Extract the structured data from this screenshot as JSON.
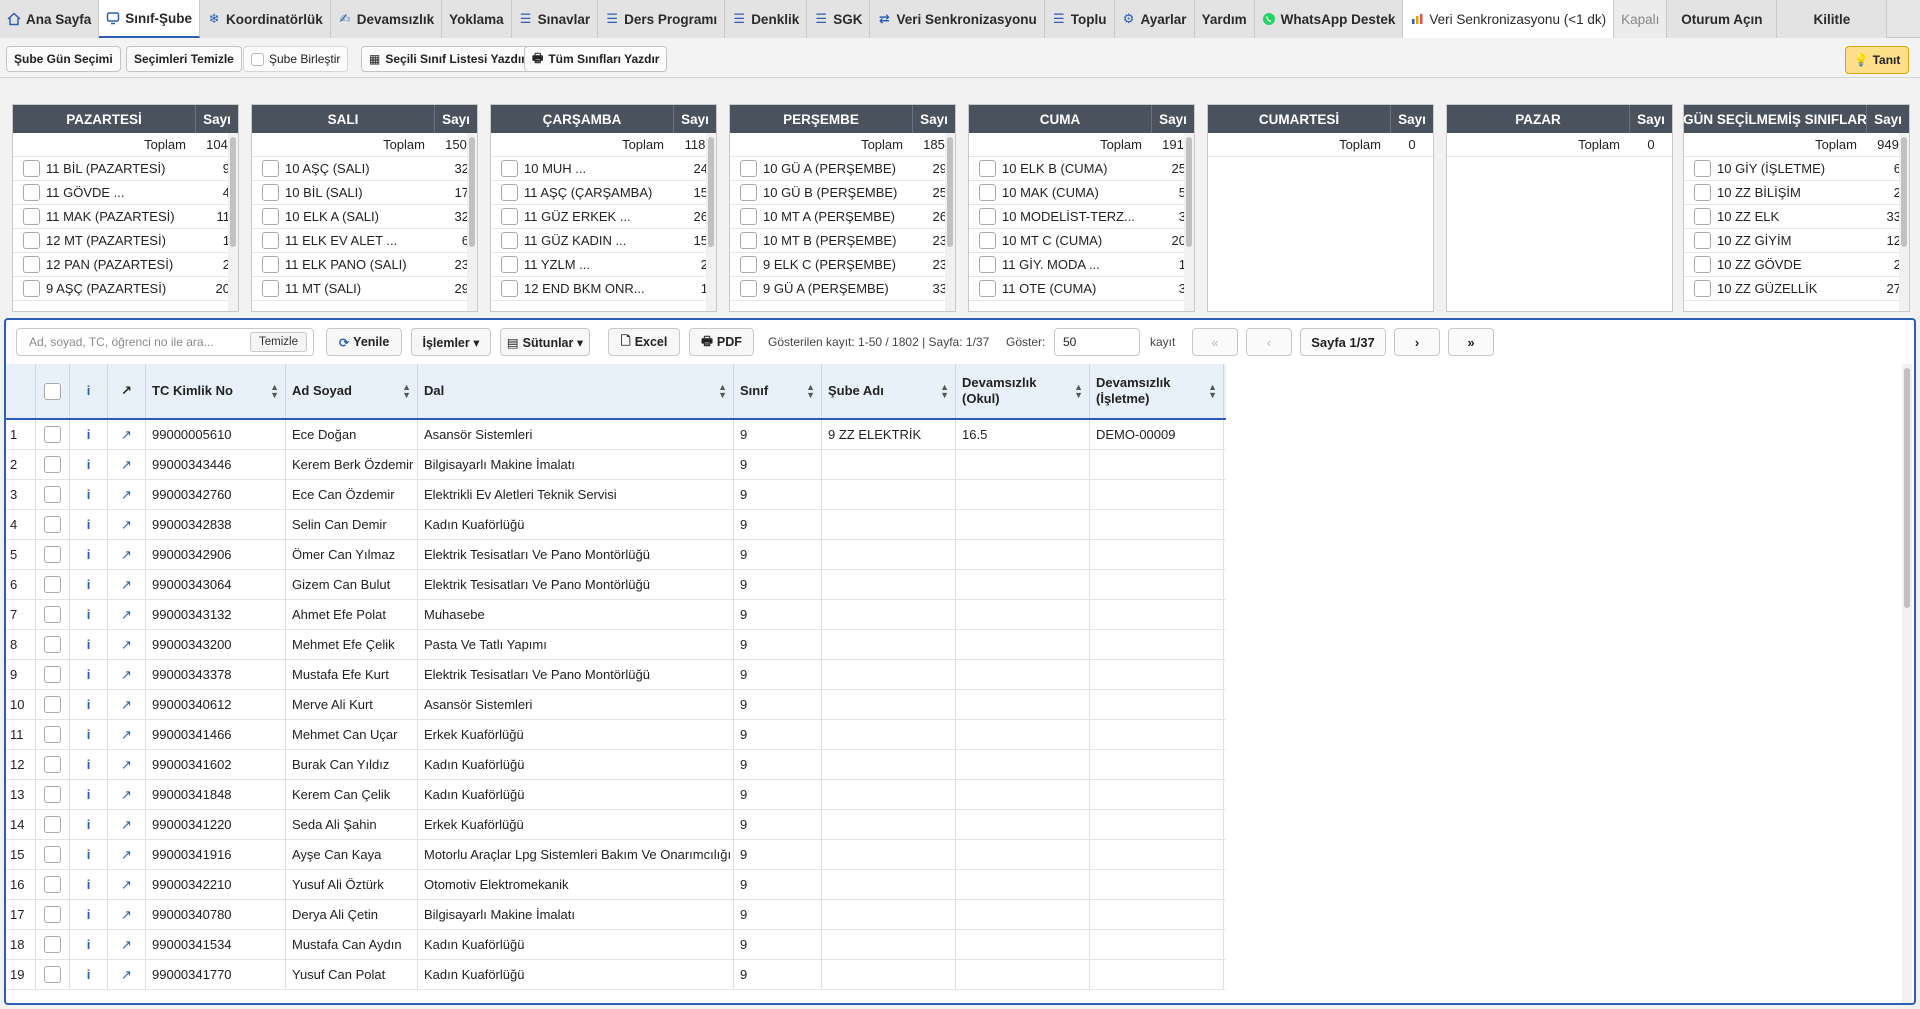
{
  "tabs": [
    {
      "label": "Ana Sayfa",
      "icon": "home-icon"
    },
    {
      "label": "Sınıf-Şube",
      "icon": "monitor-icon"
    },
    {
      "label": "Koordinatörlük",
      "icon": "snowflake-icon"
    },
    {
      "label": "Devamsızlık",
      "icon": "signature-icon"
    },
    {
      "label": "Yoklama",
      "icon": ""
    },
    {
      "label": "Sınavlar",
      "icon": "list-icon"
    },
    {
      "label": "Ders Programı",
      "icon": "list-icon"
    },
    {
      "label": "Denklik",
      "icon": "list-icon"
    },
    {
      "label": "SGK",
      "icon": "list-icon"
    },
    {
      "label": "Veri Senkronizasyonu",
      "icon": "sync-icon"
    },
    {
      "label": "Toplu",
      "icon": "list-icon"
    },
    {
      "label": "Ayarlar",
      "icon": "gear-icon"
    },
    {
      "label": "Yardım",
      "icon": ""
    },
    {
      "label": "WhatsApp Destek",
      "icon": "whatsapp-icon"
    },
    {
      "label": "Veri Senkronizasyonu (<1 dk)",
      "icon": "chart-icon"
    },
    {
      "label": "Kapalı",
      "icon": ""
    },
    {
      "label": "Oturum Açın",
      "icon": ""
    },
    {
      "label": "Kilitle",
      "icon": ""
    }
  ],
  "toolbar": {
    "sube_gun_secimi": "Şube Gün Seçimi",
    "secimleri_temizle": "Seçimleri Temizle",
    "sube_birlestir": "Şube Birleştir",
    "secili_sinif_yazdir": "Seçili Sınıf Listesi Yazdır",
    "tum_siniflari_yazdir": "Tüm Sınıfları Yazdır",
    "tanit": "Tanıt"
  },
  "days": [
    {
      "name": "PAZARTESİ",
      "count_label": "Sayı",
      "total_label": "Toplam",
      "total": "104",
      "rows": [
        [
          "11 BİL (PAZARTESİ)",
          "9"
        ],
        [
          "11 GÖVDE ...",
          "4"
        ],
        [
          "11 MAK (PAZARTESİ)",
          "11"
        ],
        [
          "12 MT (PAZARTESİ)",
          "1"
        ],
        [
          "12 PAN (PAZARTESİ)",
          "2"
        ],
        [
          "9 AŞÇ (PAZARTESİ)",
          "20"
        ]
      ]
    },
    {
      "name": "SALI",
      "count_label": "Sayı",
      "total_label": "Toplam",
      "total": "150",
      "rows": [
        [
          "10 AŞÇ (SALI)",
          "32"
        ],
        [
          "10 BİL (SALI)",
          "17"
        ],
        [
          "10 ELK A (SALI)",
          "32"
        ],
        [
          "11 ELK EV ALET ...",
          "6"
        ],
        [
          "11 ELK PANO (SALI)",
          "23"
        ],
        [
          "11 MT (SALI)",
          "29"
        ]
      ]
    },
    {
      "name": "ÇARŞAMBA",
      "count_label": "Sayı",
      "total_label": "Toplam",
      "total": "118",
      "rows": [
        [
          "10 MUH ...",
          "24"
        ],
        [
          "11 AŞÇ (ÇARŞAMBA)",
          "15"
        ],
        [
          "11 GÜZ ERKEK ...",
          "26"
        ],
        [
          "11 GÜZ KADIN ...",
          "15"
        ],
        [
          "11 YZLM ...",
          "2"
        ],
        [
          "12 END BKM ONR...",
          "1"
        ]
      ]
    },
    {
      "name": "PERŞEMBE",
      "count_label": "Sayı",
      "total_label": "Toplam",
      "total": "185",
      "rows": [
        [
          "10 GÜ A (PERŞEMBE)",
          "29"
        ],
        [
          "10 GÜ B (PERŞEMBE)",
          "25"
        ],
        [
          "10 MT A (PERŞEMBE)",
          "26"
        ],
        [
          "10 MT B (PERŞEMBE)",
          "23"
        ],
        [
          "9 ELK C (PERŞEMBE)",
          "23"
        ],
        [
          "9 GÜ A (PERŞEMBE)",
          "33"
        ]
      ]
    },
    {
      "name": "CUMA",
      "count_label": "Sayı",
      "total_label": "Toplam",
      "total": "191",
      "rows": [
        [
          "10 ELK B (CUMA)",
          "25"
        ],
        [
          "10 MAK (CUMA)",
          "5"
        ],
        [
          "10 MODELİST-TERZ...",
          "3"
        ],
        [
          "10 MT C (CUMA)",
          "20"
        ],
        [
          "11 GİY. MODA ...",
          "1"
        ],
        [
          "11 OTE (CUMA)",
          "3"
        ]
      ]
    },
    {
      "name": "CUMARTESİ",
      "count_label": "Sayı",
      "total_label": "Toplam",
      "total": "0",
      "rows": []
    },
    {
      "name": "PAZAR",
      "count_label": "Sayı",
      "total_label": "Toplam",
      "total": "0",
      "rows": []
    },
    {
      "name": "GÜN SEÇİLMEMİŞ SINIFLAR",
      "count_label": "Sayı",
      "total_label": "Toplam",
      "total": "949",
      "rows": [
        [
          "10 GİY (İŞLETME)",
          "6"
        ],
        [
          "10 ZZ BİLİŞİM",
          "2"
        ],
        [
          "10 ZZ ELK",
          "33"
        ],
        [
          "10 ZZ GİYİM",
          "12"
        ],
        [
          "10 ZZ GÖVDE",
          "2"
        ],
        [
          "10 ZZ GÜZELLİK",
          "27"
        ]
      ]
    }
  ],
  "grid": {
    "search_placeholder": "Ad, soyad, TC, öğrenci no ile ara...",
    "temizle": "Temizle",
    "yenile": "Yenile",
    "islemler": "İşlemler ▾",
    "sutunlar": "Sütunlar ▾",
    "excel": "Excel",
    "pdf": "PDF",
    "info": "Gösterilen kayıt: 1-50 / 1802 | Sayfa: 1/37",
    "goster": "Göster:",
    "page_size": "50",
    "kayit": "kayıt",
    "first": "«",
    "prev": "‹",
    "page_label": "Sayfa 1/37",
    "next": "›",
    "last": "»"
  },
  "columns": {
    "info": "i",
    "open": "↗",
    "tc": "TC Kimlik No",
    "ad": "Ad Soyad",
    "dal": "Dal",
    "sinif": "Sınıf",
    "sube": "Şube Adı",
    "dev_okul": "Devamsızlık (Okul)",
    "dev_isletme": "Devamsızlık (İşletme)"
  },
  "rows": [
    {
      "n": "1",
      "tc": "99000005610",
      "ad": "Ece Doğan",
      "dal": "Asansör Sistemleri",
      "sinif": "9",
      "sube": "9 ZZ ELEKTRİK",
      "okul": "16.5",
      "isletme": "DEMO-00009"
    },
    {
      "n": "2",
      "tc": "99000343446",
      "ad": "Kerem Berk Özdemir",
      "dal": "Bilgisayarlı Makine İmalatı",
      "sinif": "9",
      "sube": "",
      "okul": "",
      "isletme": ""
    },
    {
      "n": "3",
      "tc": "99000342760",
      "ad": "Ece Can Özdemir",
      "dal": "Elektrikli Ev Aletleri Teknik Servisi",
      "sinif": "9",
      "sube": "",
      "okul": "",
      "isletme": ""
    },
    {
      "n": "4",
      "tc": "99000342838",
      "ad": "Selin Can Demir",
      "dal": "Kadın Kuaförlüğü",
      "sinif": "9",
      "sube": "",
      "okul": "",
      "isletme": ""
    },
    {
      "n": "5",
      "tc": "99000342906",
      "ad": "Ömer Can Yılmaz",
      "dal": "Elektrik Tesisatları Ve Pano Montörlüğü",
      "sinif": "9",
      "sube": "",
      "okul": "",
      "isletme": ""
    },
    {
      "n": "6",
      "tc": "99000343064",
      "ad": "Gizem Can Bulut",
      "dal": "Elektrik Tesisatları Ve Pano Montörlüğü",
      "sinif": "9",
      "sube": "",
      "okul": "",
      "isletme": ""
    },
    {
      "n": "7",
      "tc": "99000343132",
      "ad": "Ahmet Efe Polat",
      "dal": "Muhasebe",
      "sinif": "9",
      "sube": "",
      "okul": "",
      "isletme": ""
    },
    {
      "n": "8",
      "tc": "99000343200",
      "ad": "Mehmet Efe Çelik",
      "dal": "Pasta Ve Tatlı Yapımı",
      "sinif": "9",
      "sube": "",
      "okul": "",
      "isletme": ""
    },
    {
      "n": "9",
      "tc": "99000343378",
      "ad": "Mustafa Efe Kurt",
      "dal": "Elektrik Tesisatları Ve Pano Montörlüğü",
      "sinif": "9",
      "sube": "",
      "okul": "",
      "isletme": ""
    },
    {
      "n": "10",
      "tc": "99000340612",
      "ad": "Merve Ali Kurt",
      "dal": "Asansör Sistemleri",
      "sinif": "9",
      "sube": "",
      "okul": "",
      "isletme": ""
    },
    {
      "n": "11",
      "tc": "99000341466",
      "ad": "Mehmet Can Uçar",
      "dal": "Erkek Kuaförlüğü",
      "sinif": "9",
      "sube": "",
      "okul": "",
      "isletme": ""
    },
    {
      "n": "12",
      "tc": "99000341602",
      "ad": "Burak Can Yıldız",
      "dal": "Kadın Kuaförlüğü",
      "sinif": "9",
      "sube": "",
      "okul": "",
      "isletme": ""
    },
    {
      "n": "13",
      "tc": "99000341848",
      "ad": "Kerem Can Çelik",
      "dal": "Kadın Kuaförlüğü",
      "sinif": "9",
      "sube": "",
      "okul": "",
      "isletme": ""
    },
    {
      "n": "14",
      "tc": "99000341220",
      "ad": "Seda Ali Şahin",
      "dal": "Erkek Kuaförlüğü",
      "sinif": "9",
      "sube": "",
      "okul": "",
      "isletme": ""
    },
    {
      "n": "15",
      "tc": "99000341916",
      "ad": "Ayşe Can Kaya",
      "dal": "Motorlu Araçlar Lpg Sistemleri Bakım Ve Onarımcılığı",
      "sinif": "9",
      "sube": "",
      "okul": "",
      "isletme": ""
    },
    {
      "n": "16",
      "tc": "99000342210",
      "ad": "Yusuf Ali Öztürk",
      "dal": "Otomotiv Elektromekanik",
      "sinif": "9",
      "sube": "",
      "okul": "",
      "isletme": ""
    },
    {
      "n": "17",
      "tc": "99000340780",
      "ad": "Derya Ali Çetin",
      "dal": "Bilgisayarlı Makine İmalatı",
      "sinif": "9",
      "sube": "",
      "okul": "",
      "isletme": ""
    },
    {
      "n": "18",
      "tc": "99000341534",
      "ad": "Mustafa Can Aydın",
      "dal": "Kadın Kuaförlüğü",
      "sinif": "9",
      "sube": "",
      "okul": "",
      "isletme": ""
    },
    {
      "n": "19",
      "tc": "99000341770",
      "ad": "Yusuf Can Polat",
      "dal": "Kadın Kuaförlüğü",
      "sinif": "9",
      "sube": "",
      "okul": "",
      "isletme": ""
    }
  ]
}
